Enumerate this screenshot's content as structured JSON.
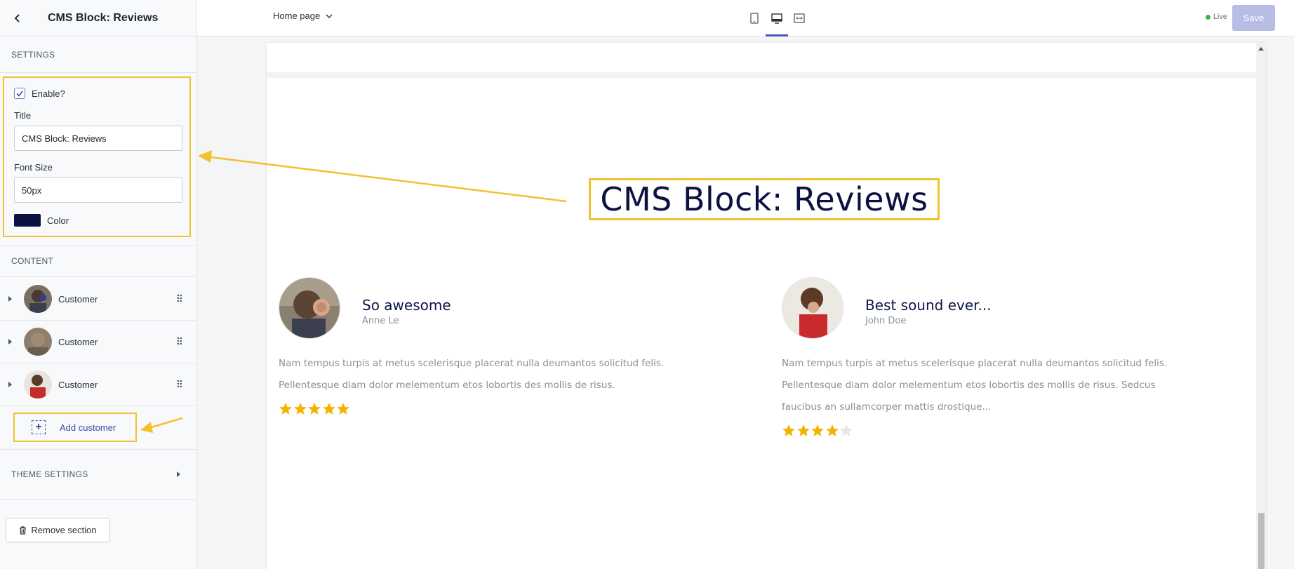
{
  "sidebar": {
    "title": "CMS Block: Reviews",
    "settings_label": "SETTINGS",
    "enable_label": "Enable?",
    "enable_checked": true,
    "title_field_label": "Title",
    "title_field_value": "CMS Block: Reviews",
    "font_size_label": "Font Size",
    "font_size_value": "50px",
    "color_label": "Color",
    "color_value": "#0b1242",
    "content_label": "CONTENT",
    "customers": [
      {
        "label": "Customer"
      },
      {
        "label": "Customer"
      },
      {
        "label": "Customer"
      }
    ],
    "add_customer_label": "Add customer",
    "theme_settings_label": "THEME SETTINGS",
    "remove_section_label": "Remove section"
  },
  "topbar": {
    "page_select": "Home page",
    "live_label": "Live",
    "save_label": "Save",
    "active_view": "desktop"
  },
  "preview": {
    "headline": "CMS Block: Reviews",
    "headline_color": "#0b1242",
    "reviews": [
      {
        "title": "So awesome",
        "author": "Anne Le",
        "text": "Nam tempus turpis at metus scelerisque placerat nulla deumantos solicitud felis. Pellentesque diam dolor melementum etos lobortis des mollis de risus.",
        "rating": 5,
        "max_rating": 5
      },
      {
        "title": "Best sound ever...",
        "author": "John Doe",
        "text": "Nam tempus turpis at metus scelerisque placerat nulla deumantos solicitud felis. Pellentesque diam dolor melementum etos lobortis des mollis de risus. Sedcus faucibus an sullamcorper mattis drostique...",
        "rating": 4,
        "max_rating": 5
      }
    ]
  },
  "colors": {
    "accent": "#4a56b8",
    "highlight": "#f2c12e",
    "star": "#f5b301",
    "star_empty": "#e6e6e6"
  }
}
